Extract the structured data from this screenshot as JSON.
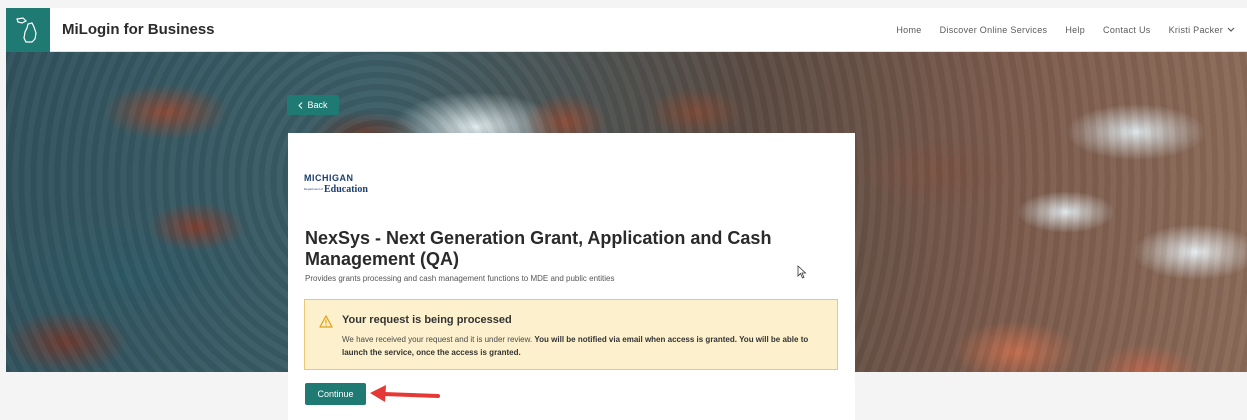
{
  "header": {
    "brand": "MiLogin for Business",
    "nav": [
      "Home",
      "Discover Online Services",
      "Help",
      "Contact Us"
    ],
    "user": "Kristi Packer",
    "icons": {
      "logo": "michigan-state-icon",
      "user_menu": "chevron-down-icon"
    }
  },
  "back_label": "Back",
  "service": {
    "logo_line1": "MICHIGAN",
    "logo_line2": "Education",
    "logo_line0": "Department of",
    "title": "NexSys - Next Generation Grant, Application and Cash Management (QA)",
    "description": "Provides grants processing and cash management functions to MDE and public entities"
  },
  "alert": {
    "title": "Your request is being processed",
    "body_plain": "We have received your request and it is under review. ",
    "body_bold": "You will be notified via email when access is granted. You will be able to launch the service, once the access is granted.",
    "icon": "warning-icon"
  },
  "continue_label": "Continue",
  "colors": {
    "accent": "#1e7a73",
    "alert_bg": "#fdf0cc",
    "alert_border": "#e9c878",
    "annotation_arrow": "#e53935"
  }
}
